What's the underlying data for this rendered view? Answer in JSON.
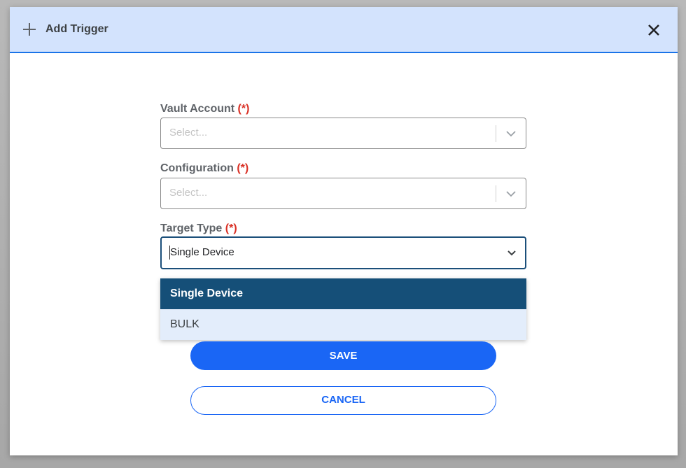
{
  "dialog": {
    "title": "Add Trigger",
    "icons": {
      "header": "plus-icon",
      "close": "close-icon"
    }
  },
  "form": {
    "vault_account": {
      "label": "Vault Account",
      "required_mark": "(*)",
      "placeholder": "Select..."
    },
    "configuration": {
      "label": "Configuration",
      "required_mark": "(*)",
      "placeholder": "Select..."
    },
    "target_type": {
      "label": "Target Type",
      "required_mark": "(*)",
      "value": "Single Device",
      "options": [
        "Single Device",
        "BULK"
      ],
      "selected_index": 0
    }
  },
  "actions": {
    "save_label": "SAVE",
    "cancel_label": "CANCEL"
  },
  "colors": {
    "header_bg": "#d3e3fd",
    "accent": "#1a66f5",
    "selected_option_bg": "#154f78",
    "required": "#d93025"
  }
}
